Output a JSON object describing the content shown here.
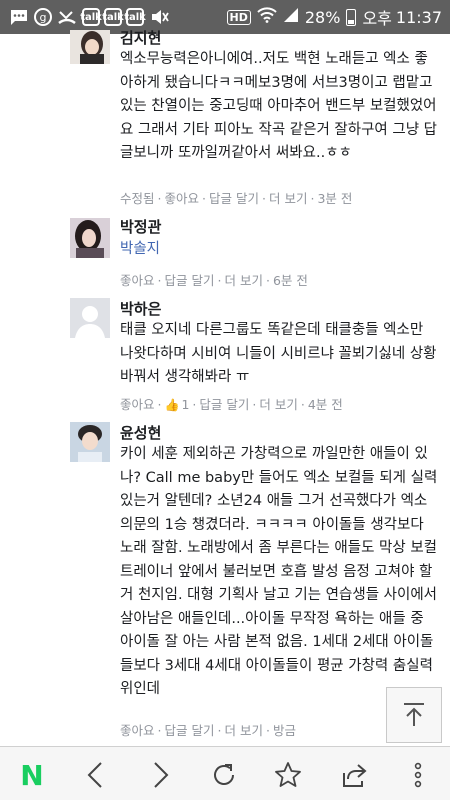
{
  "status_bar": {
    "battery": "28%",
    "period": "오후",
    "time": "11:37",
    "hd_label": "HD",
    "left_icons": [
      "message-icon",
      "g-icon",
      "missed-call-icon",
      "talk-icon",
      "talk-icon",
      "talk-icon",
      "mute-icon"
    ]
  },
  "comments": [
    {
      "name": "김지현",
      "text": "엑소무능력은아니에여..저도 백현 노래듣고 엑소 좋아하게 됐습니다ㅋㅋ메보3명에 서브3명이고 랩맡고있는 찬열이는 중고딩때 아마추어 밴드부 보컬했었어요 그래서 기타 피아노 작곡 같은거 잘하구여 그냥 답글보니까 또까일꺼같아서 써봐요..ㅎㅎ",
      "actions": [
        "수정됨",
        "좋아요",
        "답글 달기",
        "더 보기",
        "3분 전"
      ]
    },
    {
      "name": "박정관",
      "text": "박솔지",
      "actions": [
        "좋아요",
        "답글 달기",
        "더 보기",
        "6분 전"
      ]
    },
    {
      "name": "박하은",
      "text": "태클 오지네 다른그룹도 똑같은데 태클충들 엑소만 나왓다하며 시비여 니들이 시비르냐 꼴뵈기싫네 상황바꿔서 생각해봐라 ㅠ",
      "actions": [
        "좋아요",
        "1",
        "답글 달기",
        "더 보기",
        "4분 전"
      ]
    },
    {
      "name": "윤성현",
      "text": "카이 세훈 제외하곤 가창력으로 까일만한 애들이 있나? Call me baby만 들어도 엑소 보컬들 되게 실력있는거 알텐데? 소년24 애들 그거 선곡했다가 엑소 의문의 1승 챙겼더라. ㅋㅋㅋㅋ 아이돌들 생각보다 노래 잘함. 노래방에서 좀 부른다는 애들도 막상 보컬 트레이너 앞에서 불러보면 호흡 발성 음정 고쳐야 할거 천지임. 대형 기획사 날고 기는 연습생들 사이에서 살아남은 애들인데...아이돌 무작정 욕하는 애들 중 아이돌 잘 아는 사람 본적 없음. 1세대 2세대 아이돌들보다 3세대 4세대 아이돌들이 평균 가창력 춤실력 위인데",
      "actions": [
        "좋아요",
        "답글 달기",
        "더 보기",
        "방금"
      ]
    }
  ],
  "bottom_nav": {
    "logo": "N",
    "icons": [
      "back-icon",
      "forward-icon",
      "reload-icon",
      "bookmark-star-icon",
      "share-icon",
      "more-menu-icon"
    ]
  },
  "colors": {
    "status_bar": "#5f5f5f",
    "link_blue": "#4267b2",
    "meta_gray": "#90949c",
    "naver_green": "#19ce60"
  }
}
